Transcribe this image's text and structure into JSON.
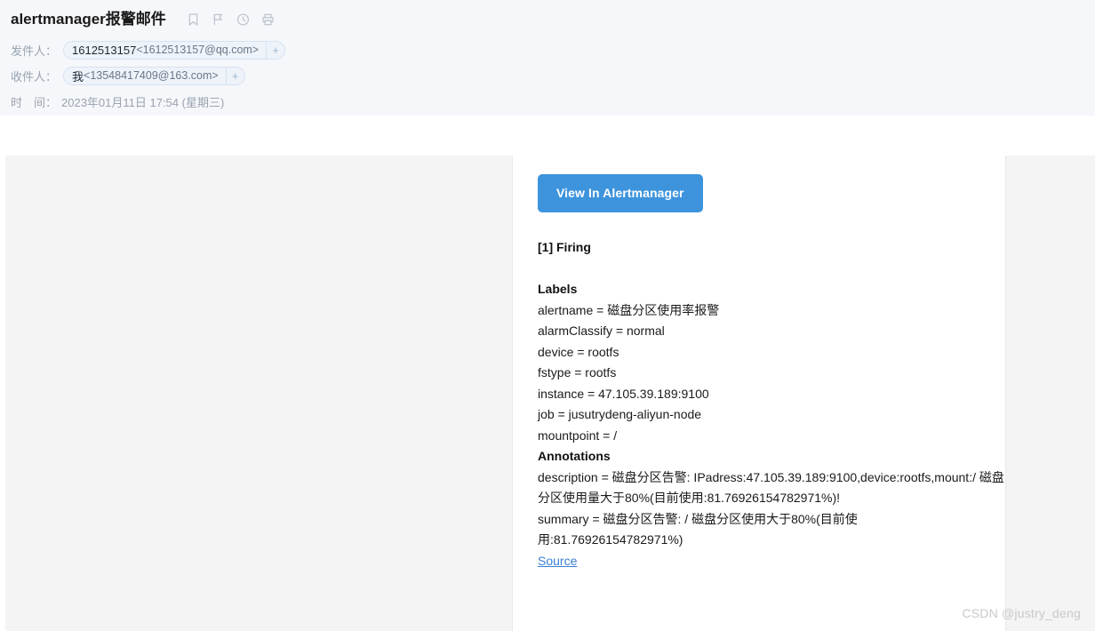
{
  "mail": {
    "subject": "alertmanager报警邮件",
    "header_icons": [
      {
        "name": "bookmark-icon",
        "label": "bookmark"
      },
      {
        "name": "flag-icon",
        "label": "flag"
      },
      {
        "name": "clock-icon",
        "label": "clock"
      },
      {
        "name": "print-icon",
        "label": "print"
      }
    ],
    "sender": {
      "label": "发件人：",
      "chip_name": "1612513157",
      "chip_address": "<1612513157@qq.com>",
      "add_label": "+"
    },
    "recipient": {
      "label": "收件人：",
      "chip_name": "我",
      "chip_address": "<13548417409@163.com>",
      "add_label": "+"
    },
    "time": {
      "label": "时　间：",
      "value": "2023年01月11日 17:54 (星期三)"
    }
  },
  "body": {
    "view_button": "View In Alertmanager",
    "firing_heading": "[1] Firing",
    "labels_heading": "Labels",
    "labels": [
      "alertname = 磁盘分区使用率报警",
      "alarmClassify = normal",
      "device = rootfs",
      "fstype = rootfs",
      "instance = 47.105.39.189:9100",
      "job = jusutrydeng-aliyun-node",
      "mountpoint = /"
    ],
    "annotations_heading": "Annotations",
    "annotations": [
      {
        "text": "description = 磁盘分区告警: IPadress:47.105.39.189:9100,device:rootfs,mount:/ 磁盘分区使用量大于80%(目前使用:81.76926154782971%)!",
        "narrow": false
      },
      {
        "text": "summary = 磁盘分区告警:  / 磁盘分区使用大于80%(目前使用:81.76926154782971%)",
        "narrow": true
      }
    ],
    "source_link": "Source"
  },
  "watermark": "CSDN @justry_deng",
  "colors": {
    "button_blue": "#3d94dd",
    "link_blue": "#3b7fd4",
    "header_bg": "#f5f7fa",
    "panel_gray": "#f4f4f4",
    "chip_bg": "#eef3fa"
  }
}
